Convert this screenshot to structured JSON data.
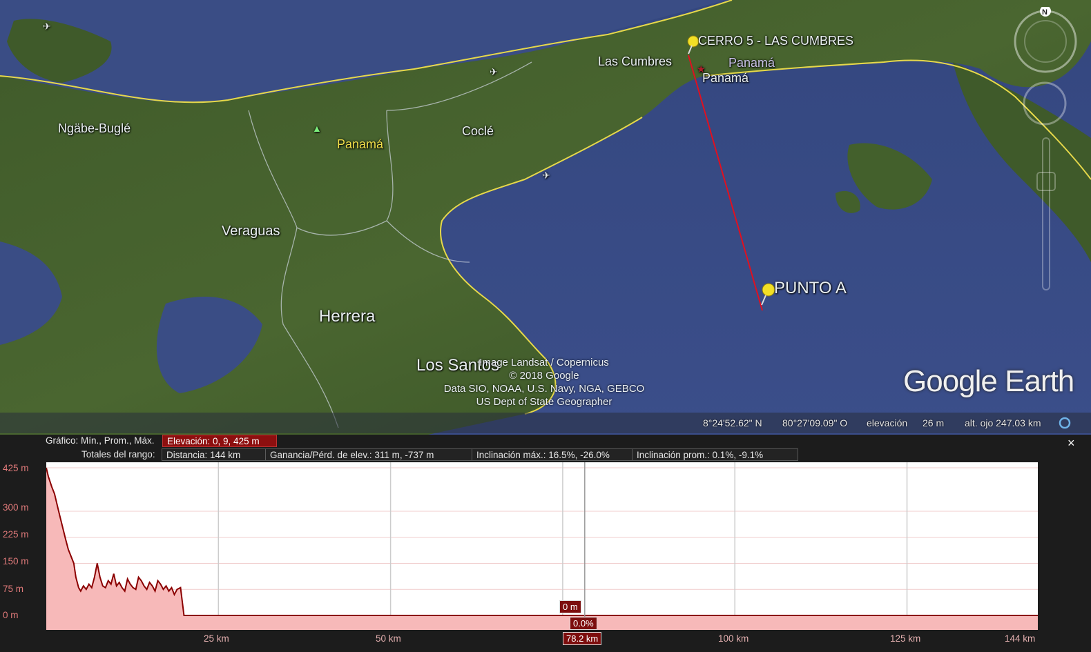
{
  "map": {
    "labels": {
      "ngabe": "Ngäbe-Buglé",
      "panama_province": "Panamá",
      "cocle": "Coclé",
      "veraguas": "Veraguas",
      "herrera": "Herrera",
      "los_santos": "Los Santos",
      "las_cumbres": "Las Cumbres",
      "panama_city": "Panamá",
      "panama_upper": "Panamá"
    },
    "placemarks": {
      "cerro": "CERRO 5 - LAS CUMBRES",
      "punto_a": "PUNTO A"
    },
    "attribution": [
      "Image Landsat / Copernicus",
      "© 2018 Google",
      "Data SIO, NOAA, U.S. Navy, NGA, GEBCO",
      "US Dept of State Geographer"
    ],
    "brand": "Google Earth",
    "compass_north": "N",
    "status": {
      "lat": "8°24'52.62\" N",
      "lon": "80°27'09.09\" O",
      "elev_label": "elevación",
      "elev_value": "26 m",
      "eye_alt": "alt. ojo 247.03 km"
    },
    "colors": {
      "path_line": "#e01020",
      "border": "#e6d84a"
    }
  },
  "profile": {
    "row1_label": "Gráfico: Mín., Prom., Máx.",
    "elevation_pill": "Elevación: 0, 9, 425 m",
    "row2_label": "Totales del rango:",
    "distance": "Distancia: 144 km",
    "gain_loss": "Ganancia/Pérd. de elev.: 311 m, -737 m",
    "max_slope": "Inclinación máx.: 16.5%, -26.0%",
    "avg_slope": "Inclinación prom.: 0.1%, -9.1%",
    "close": "×",
    "cursor": {
      "elevation": "0 m",
      "slope": "0.0%",
      "distance": "78.2 km"
    }
  },
  "chart_data": {
    "type": "area",
    "title": "",
    "xlabel": "",
    "ylabel": "",
    "y_ticks": [
      "425 m",
      "300 m",
      "225 m",
      "150 m",
      "75 m",
      "0 m"
    ],
    "x_ticks": [
      "25 km",
      "50 km",
      "100 km",
      "125 km",
      "144 km"
    ],
    "xlim": [
      0,
      144
    ],
    "ylim": [
      0,
      425
    ],
    "series": [
      {
        "x": [
          0,
          0.3,
          0.8,
          1.2,
          1.8,
          2.3,
          2.8,
          3.2,
          3.6,
          4.0,
          4.3,
          4.7,
          5.0,
          5.4,
          5.8,
          6.2,
          6.6,
          7.0,
          7.4,
          7.8,
          8.2,
          8.6,
          9.0,
          9.4,
          9.8,
          10.2,
          10.6,
          11.0,
          11.4,
          11.8,
          12.2,
          12.6,
          13.0,
          13.4,
          13.8,
          14.2,
          14.6,
          15.0,
          15.4,
          15.8,
          16.2,
          16.6,
          17.0,
          17.4,
          17.8,
          18.2,
          18.6,
          19.0,
          19.5,
          20,
          30,
          40,
          50,
          60,
          70,
          78.2,
          90,
          100,
          110,
          120,
          130,
          144
        ],
        "y": [
          425,
          400,
          370,
          350,
          300,
          260,
          220,
          190,
          170,
          150,
          110,
          80,
          70,
          85,
          75,
          90,
          80,
          110,
          150,
          110,
          85,
          80,
          100,
          90,
          120,
          85,
          95,
          80,
          70,
          105,
          90,
          80,
          75,
          110,
          100,
          85,
          75,
          95,
          85,
          70,
          100,
          90,
          75,
          85,
          70,
          80,
          60,
          75,
          80,
          0,
          0,
          0,
          0,
          0,
          0,
          0,
          0,
          0,
          0,
          0,
          0,
          0
        ]
      }
    ],
    "grid": true,
    "colors": {
      "fill": "#f7b9b9",
      "line": "#8b0000",
      "grid": "#cccccc",
      "cursor_line": "#999999"
    },
    "cursor_x": 78.2,
    "cursor_x2": 75
  }
}
